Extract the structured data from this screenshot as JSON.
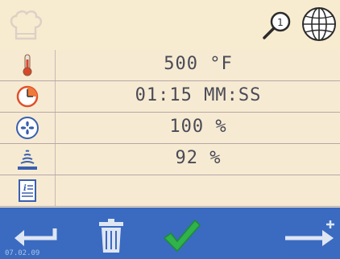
{
  "header": {
    "search_badge": "1"
  },
  "rows": [
    {
      "icon": "thermometer-icon",
      "value": "500 °F"
    },
    {
      "icon": "clock-icon",
      "value": "01:15 MM:SS"
    },
    {
      "icon": "fan-icon",
      "value": "100 %"
    },
    {
      "icon": "microwave-icon",
      "value": "92 %"
    },
    {
      "icon": "notes-icon",
      "value": ""
    }
  ],
  "footer": {
    "date": "07.02.09"
  },
  "colors": {
    "screen_bg": "#f7ecd2",
    "footer_bg": "#3a6bc0",
    "accent_green": "#2fb34a",
    "text": "#4a4a57"
  }
}
